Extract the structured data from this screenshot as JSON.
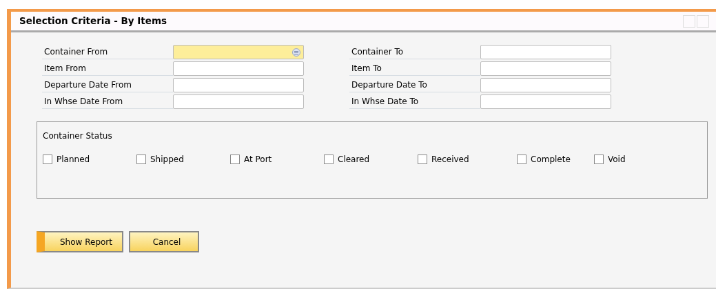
{
  "window": {
    "title": "Selection Criteria - By Items"
  },
  "fields": [
    {
      "label": "Container From",
      "focused": true
    },
    {
      "label": "Container To",
      "focused": false
    },
    {
      "label": "Item From",
      "focused": false
    },
    {
      "label": "Item To",
      "focused": false
    },
    {
      "label": "Departure Date From",
      "focused": false
    },
    {
      "label": "Departure Date To",
      "focused": false
    },
    {
      "label": "In Whse Date From",
      "focused": false
    },
    {
      "label": "In Whse Date To",
      "focused": false
    }
  ],
  "container_status": {
    "title": "Container Status",
    "options": [
      {
        "label": "Planned",
        "checked": false
      },
      {
        "label": "Shipped",
        "checked": false
      },
      {
        "label": "At Port",
        "checked": false
      },
      {
        "label": "Cleared",
        "checked": false
      },
      {
        "label": "Received",
        "checked": false
      },
      {
        "label": "Complete",
        "checked": false
      },
      {
        "label": "Void",
        "checked": false
      }
    ]
  },
  "buttons": [
    {
      "label": "Show Report",
      "selected": true
    },
    {
      "label": "Cancel",
      "selected": false
    }
  ]
}
